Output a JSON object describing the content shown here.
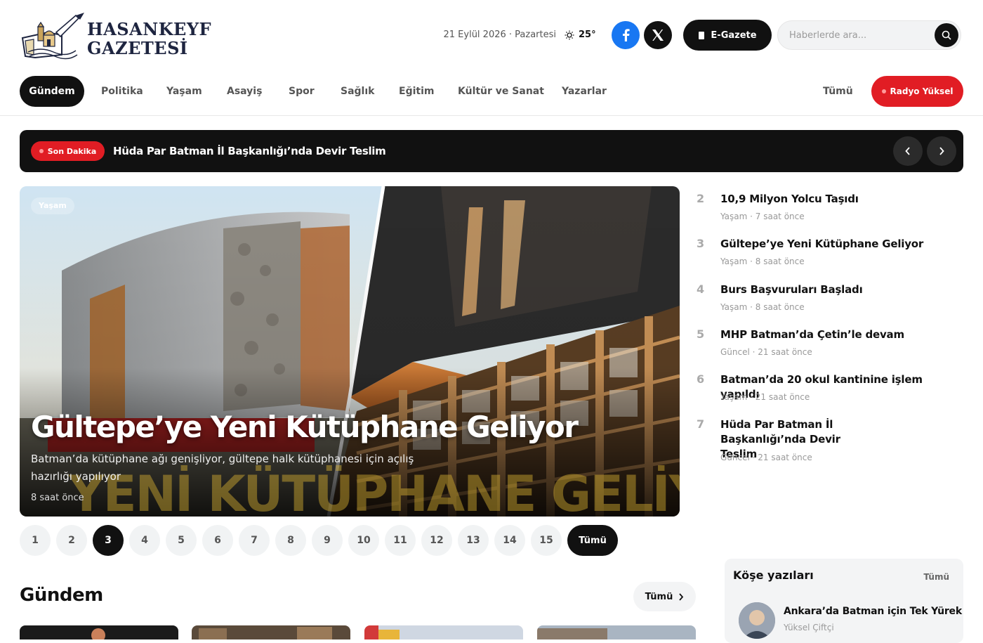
{
  "header": {
    "logo_line1": "HASANKEYF",
    "logo_line2": "GAZETESİ",
    "date": "21 Eylül 2026 · Pazartesi",
    "temperature": "25°",
    "weather_icon": "sun-icon",
    "egazete_label": "E-Gazete",
    "search_placeholder": "Haberlerde ara..."
  },
  "nav": {
    "items": [
      "Gündem",
      "Politika",
      "Yaşam",
      "Asayiş",
      "Spor",
      "Sağlık",
      "Eğitim",
      "Kültür ve Sanat",
      "Yazarlar"
    ],
    "active": "Gündem",
    "all_label": "Tümü",
    "radio_label": "Radyo Yüksel"
  },
  "breaking": {
    "badge": "Son Dakika",
    "headline": "Hüda Par Batman İl Başkanlığı’nda Devir Teslim"
  },
  "hero": {
    "category": "Yaşam",
    "title": "Gültepe’ye Yeni Kütüphane Geliyor",
    "description": "Batman’da kütüphane ağı genişliyor, gültepe halk kütüphanesi için açılış hazırlığı yapılıyor",
    "time": "8 saat önce",
    "image_caption": "YENİ KÜTÜPHANE GELİYOR"
  },
  "side_news": [
    {
      "num": "2",
      "title": "10,9 Milyon Yolcu Taşıdı",
      "meta": "Yaşam · 7 saat önce"
    },
    {
      "num": "3",
      "title": "Gültepe’ye Yeni Kütüphane Geliyor",
      "meta": "Yaşam · 8 saat önce"
    },
    {
      "num": "4",
      "title": "Burs Başvuruları Başladı",
      "meta": "Yaşam · 8 saat önce"
    },
    {
      "num": "5",
      "title": "MHP Batman’da Çetin’le devam",
      "meta": "Güncel · 21 saat önce"
    },
    {
      "num": "6",
      "title": "Batman’da 20 okul kantinine işlem yapıldı",
      "meta": "Yaşam · 21 saat önce"
    },
    {
      "num": "7",
      "title": "Hüda Par Batman İl Başkanlığı’nda Devir Teslim",
      "meta": "Güncel · 21 saat önce"
    }
  ],
  "pagination": {
    "pages": [
      "1",
      "2",
      "3",
      "4",
      "5",
      "6",
      "7",
      "8",
      "9",
      "10",
      "11",
      "12",
      "13",
      "14",
      "15"
    ],
    "active": "3",
    "all_label": "Tümü"
  },
  "section": {
    "title": "Gündem",
    "all_label": "Tümü"
  },
  "columns": {
    "title": "Köşe yazıları",
    "all_label": "Tümü",
    "article_title": "Ankara’da Batman için Tek Yürek",
    "author": "Yüksel Çiftçi"
  },
  "colors": {
    "accent_red": "#e11d24",
    "dark": "#111111",
    "facebook": "#1877f2"
  }
}
